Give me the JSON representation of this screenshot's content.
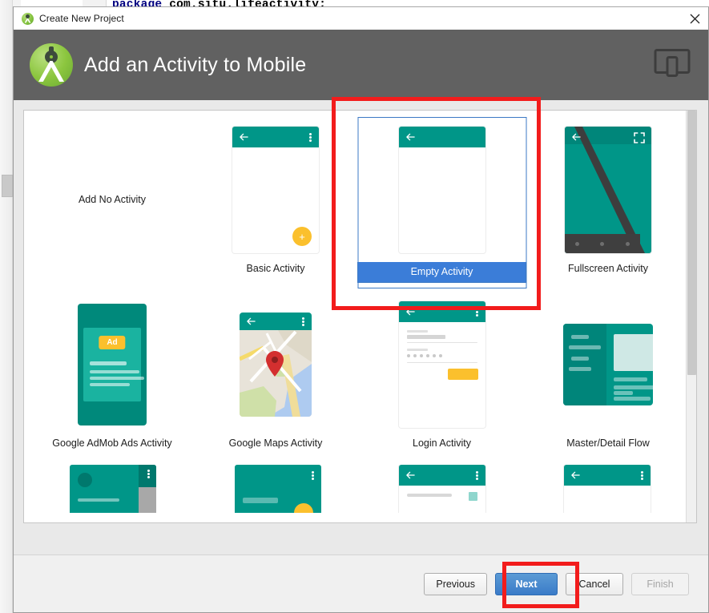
{
  "background": {
    "code_keyword": "package",
    "code_rest": " com.situ.lifeactivity;"
  },
  "titlebar": {
    "icon": "android-studio-icon",
    "title": "Create New Project",
    "close_label": "close-icon"
  },
  "header": {
    "logo": "android-studio-logo",
    "title": "Add an Activity to Mobile",
    "device_icon": "tablet-phone-icon"
  },
  "templates": [
    {
      "label": "Add No Activity",
      "thumb": "none",
      "selected": false
    },
    {
      "label": "Basic Activity",
      "thumb": "basic",
      "selected": false
    },
    {
      "label": "Empty Activity",
      "thumb": "empty",
      "selected": true
    },
    {
      "label": "Fullscreen Activity",
      "thumb": "fullscreen",
      "selected": false
    },
    {
      "label": "Google AdMob Ads Activity",
      "thumb": "admob",
      "selected": false
    },
    {
      "label": "Google Maps Activity",
      "thumb": "maps",
      "selected": false
    },
    {
      "label": "Login Activity",
      "thumb": "login",
      "selected": false
    },
    {
      "label": "Master/Detail Flow",
      "thumb": "masterdetail",
      "selected": false
    }
  ],
  "partial_row": [
    {
      "thumb": "navdrawer"
    },
    {
      "thumb": "scrolling"
    },
    {
      "thumb": "settings"
    },
    {
      "thumb": "tabbed"
    }
  ],
  "admob_badge": "Ad",
  "fab_glyph": "+",
  "footer": {
    "previous": "Previous",
    "next": "Next",
    "cancel": "Cancel",
    "finish": "Finish"
  },
  "colors": {
    "header_bg": "#616161",
    "accent_teal": "#009688",
    "accent_amber": "#fbc02d",
    "selection_blue": "#3b7dd8",
    "annotation_red": "#f21c1c"
  }
}
